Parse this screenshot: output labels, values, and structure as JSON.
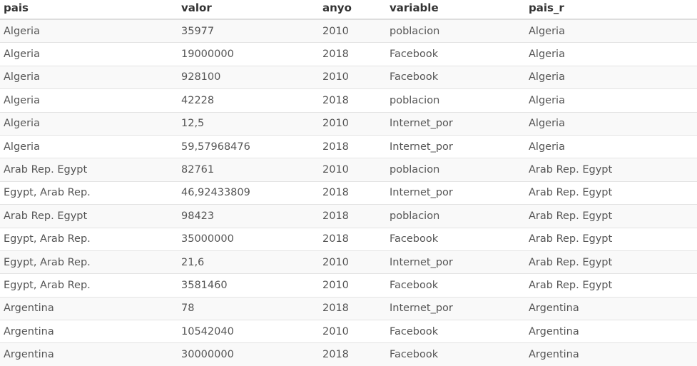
{
  "table": {
    "columns": [
      "pais",
      "valor",
      "anyo",
      "variable",
      "pais_r"
    ],
    "rows": [
      [
        "Algeria",
        "35977",
        "2010",
        "poblacion",
        "Algeria"
      ],
      [
        "Algeria",
        "19000000",
        "2018",
        "Facebook",
        "Algeria"
      ],
      [
        "Algeria",
        "928100",
        "2010",
        "Facebook",
        "Algeria"
      ],
      [
        "Algeria",
        "42228",
        "2018",
        "poblacion",
        "Algeria"
      ],
      [
        "Algeria",
        "12,5",
        "2010",
        "Internet_por",
        "Algeria"
      ],
      [
        "Algeria",
        "59,57968476",
        "2018",
        "Internet_por",
        "Algeria"
      ],
      [
        "Arab Rep. Egypt",
        "82761",
        "2010",
        "poblacion",
        "Arab Rep. Egypt"
      ],
      [
        "Egypt, Arab Rep.",
        "46,92433809",
        "2018",
        "Internet_por",
        "Arab Rep. Egypt"
      ],
      [
        "Arab Rep. Egypt",
        "98423",
        "2018",
        "poblacion",
        "Arab Rep. Egypt"
      ],
      [
        "Egypt, Arab Rep.",
        "35000000",
        "2018",
        "Facebook",
        "Arab Rep. Egypt"
      ],
      [
        "Egypt, Arab Rep.",
        "21,6",
        "2010",
        "Internet_por",
        "Arab Rep. Egypt"
      ],
      [
        "Egypt, Arab Rep.",
        "3581460",
        "2010",
        "Facebook",
        "Arab Rep. Egypt"
      ],
      [
        "Argentina",
        "78",
        "2018",
        "Internet_por",
        "Argentina"
      ],
      [
        "Argentina",
        "10542040",
        "2010",
        "Facebook",
        "Argentina"
      ],
      [
        "Argentina",
        "30000000",
        "2018",
        "Facebook",
        "Argentina"
      ]
    ]
  }
}
